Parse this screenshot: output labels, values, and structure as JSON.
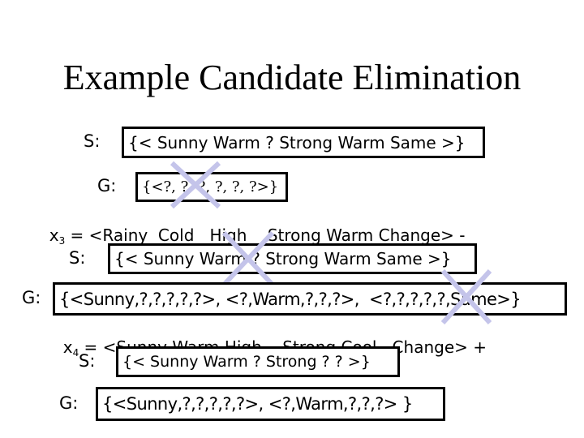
{
  "title": "Example Candidate Elimination",
  "step_initial": {
    "s_label": "S:",
    "s_value": "{< Sunny Warm ? Strong Warm Same >}",
    "g_label": "G:",
    "g_value": "{<?, ?, ?, ?, ?, ?>}",
    "g_crossed_out": true
  },
  "example_x3": {
    "var": "x",
    "subscript": "3",
    "text": " = <Rainy  Cold   High    Strong Warm Change> -",
    "label": "-"
  },
  "step_x3": {
    "s_label": "S:",
    "s_value": "{< Sunny Warm ? Strong Warm Same >}",
    "s_crossed_out": true,
    "g_label": "G:",
    "g_value": "{<Sunny,?,?,?,?,?>, <?,Warm,?,?,?>,  <?,?,?,?,?,Same>}",
    "g_partially_crossed_out": true
  },
  "example_x4": {
    "var": "x",
    "subscript": "4",
    "text": " = <Sunny Warm High    Strong Cool   Change> +",
    "label": "+"
  },
  "step_x4": {
    "s_label": "S:",
    "s_value": "{< Sunny Warm ? Strong ? ? >}",
    "g_label": "G:",
    "g_value": "{<Sunny,?,?,?,?,?>, <?,Warm,?,?,?> }"
  },
  "colors": {
    "cross": "#c4c4ea",
    "text": "#000000",
    "background": "#ffffff"
  }
}
